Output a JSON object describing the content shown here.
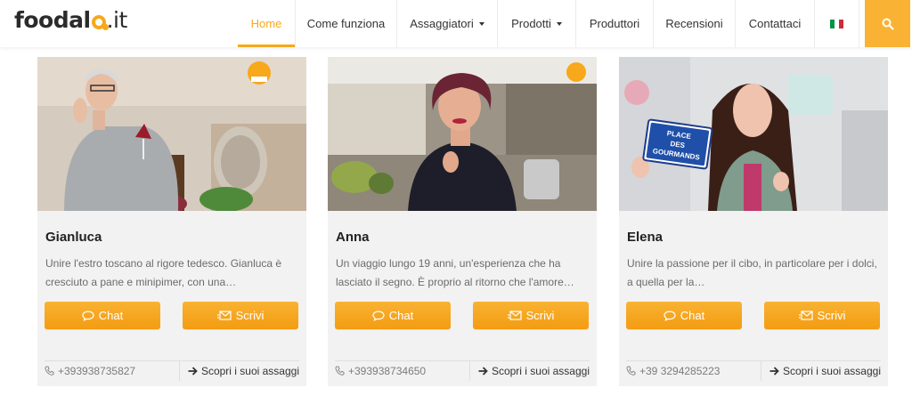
{
  "brand": {
    "name": "foodal",
    "tld": ".it",
    "accent": "#f7a81b"
  },
  "nav": {
    "items": [
      {
        "label": "Home",
        "active": true
      },
      {
        "label": "Come funziona"
      },
      {
        "label": "Assaggiatori",
        "dropdown": true
      },
      {
        "label": "Prodotti",
        "dropdown": true
      },
      {
        "label": "Produttori"
      },
      {
        "label": "Recensioni"
      },
      {
        "label": "Contattaci"
      }
    ],
    "language_icon": "italian-flag-icon",
    "search_icon": "search-icon"
  },
  "cards": [
    {
      "name": "Gianluca",
      "description": "Unire l'estro toscano al rigore tedesco. Gianluca è cresciuto a pane e minipimer, con una…",
      "chat_label": "Chat",
      "write_label": "Scrivi",
      "phone": "+393938735827",
      "link_label": "Scopri i suoi assaggi"
    },
    {
      "name": "Anna",
      "description": "Un viaggio lungo 19 anni, un'esperienza che ha lasciato il segno. È proprio al ritorno che l'amore…",
      "chat_label": "Chat",
      "write_label": "Scrivi",
      "phone": "+393938734650",
      "link_label": "Scopri i suoi assaggi"
    },
    {
      "name": "Elena",
      "description": "Unire la passione per il cibo, in particolare per i dolci, a quella per la…",
      "chat_label": "Chat",
      "write_label": "Scrivi",
      "phone": "+39 3294285223",
      "link_label": "Scopri i suoi assaggi",
      "photo_sign": [
        "PLACE",
        "DES",
        "GOURMANDS"
      ]
    }
  ],
  "icons": {
    "chat": "chat-bubble-icon",
    "write": "envelope-icon",
    "phone": "phone-icon",
    "link": "arrow-right-icon"
  }
}
